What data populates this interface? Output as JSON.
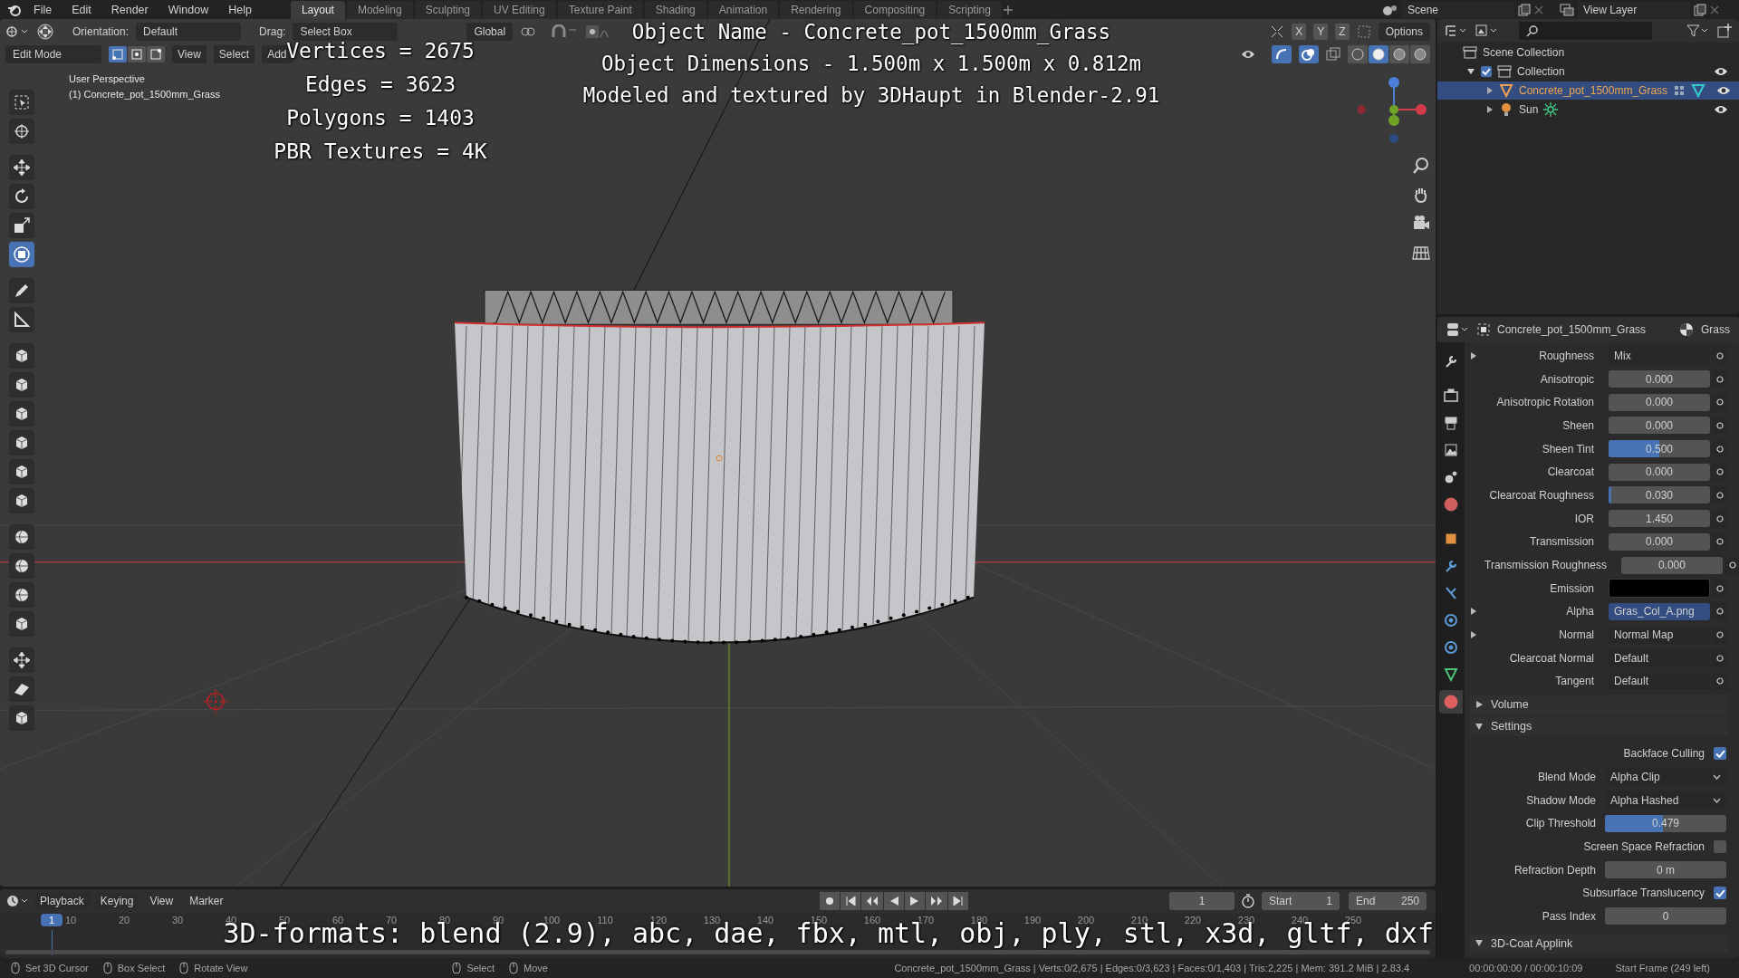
{
  "menu": [
    "File",
    "Edit",
    "Render",
    "Window",
    "Help"
  ],
  "workspace_tabs": [
    {
      "label": "Layout",
      "selected": true
    },
    {
      "label": "Modeling",
      "selected": false
    },
    {
      "label": "Sculpting",
      "selected": false
    },
    {
      "label": "UV Editing",
      "selected": false
    },
    {
      "label": "Texture Paint",
      "selected": false
    },
    {
      "label": "Shading",
      "selected": false
    },
    {
      "label": "Animation",
      "selected": false
    },
    {
      "label": "Rendering",
      "selected": false
    },
    {
      "label": "Compositing",
      "selected": false
    },
    {
      "label": "Scripting",
      "selected": false
    }
  ],
  "scene": "Scene",
  "view_layer": "View Layer",
  "viewport_header": {
    "orientation_label": "Orientation:",
    "orientation": "Default",
    "drag_label": "Drag:",
    "drag": "Select Box",
    "mode": "Edit Mode",
    "menus": [
      "View",
      "Select",
      "Add"
    ],
    "transform": "Global",
    "axes": [
      "X",
      "Y",
      "Z"
    ],
    "options": "Options",
    "select_modes": [
      {
        "selected": true
      },
      {
        "selected": false
      },
      {
        "selected": false
      }
    ],
    "shading_modes": [
      {
        "selected": false
      },
      {
        "selected": true
      },
      {
        "selected": false
      },
      {
        "selected": false
      }
    ]
  },
  "viewport": {
    "view_name": "User Perspective",
    "object_label": "(1) Concrete_pot_1500mm_Grass"
  },
  "overlay_stats": [
    "Vertices = 2675",
    "Edges = 3623",
    "Polygons = 1403",
    "PBR Textures = 4K"
  ],
  "overlay_info": [
    "Object Name - Concrete_pot_1500mm_Grass",
    "Object Dimensions -  1.500m x 1.500m x 0.812m",
    "Modeled and textured by 3DHaupt in Blender-2.91"
  ],
  "overlay_formats": "3D-formats: blend (2.9), abc, dae, fbx, mtl, obj, ply, stl, x3d, gltf, dxf",
  "outliner": {
    "root": "Scene Collection",
    "items": [
      {
        "label": "Collection",
        "checked": true,
        "expanded": true,
        "children": [
          {
            "label": "Concrete_pot_1500mm_Grass",
            "selected": true,
            "kind": "mesh"
          },
          {
            "label": "Sun",
            "selected": false,
            "kind": "light"
          }
        ]
      }
    ]
  },
  "properties": {
    "object": "Concrete_pot_1500mm_Grass",
    "material": "Grass",
    "rows": [
      {
        "kind": "link",
        "label": "Roughness",
        "value": "Mix",
        "expandable": true
      },
      {
        "kind": "slider",
        "label": "Anisotropic",
        "value": "0.000",
        "level": 0
      },
      {
        "kind": "slider",
        "label": "Anisotropic Rotation",
        "value": "0.000",
        "level": 0
      },
      {
        "kind": "slider",
        "label": "Sheen",
        "value": "0.000",
        "level": 0
      },
      {
        "kind": "slider",
        "label": "Sheen Tint",
        "value": "0.500",
        "level": 0.5
      },
      {
        "kind": "slider",
        "label": "Clearcoat",
        "value": "0.000",
        "level": 0
      },
      {
        "kind": "slider",
        "label": "Clearcoat Roughness",
        "value": "0.030",
        "level": 0.03
      },
      {
        "kind": "number",
        "label": "IOR",
        "value": "1.450"
      },
      {
        "kind": "slider",
        "label": "Transmission",
        "value": "0.000",
        "level": 0
      },
      {
        "kind": "slider",
        "label": "Transmission Roughness",
        "value": "0.000",
        "level": 0
      },
      {
        "kind": "color",
        "label": "Emission",
        "color": "#000000"
      },
      {
        "kind": "texture",
        "label": "Alpha",
        "value": "Gras_Col_A.png",
        "expandable": true
      },
      {
        "kind": "link",
        "label": "Normal",
        "value": "Normal Map",
        "expandable": true
      },
      {
        "kind": "link",
        "label": "Clearcoat Normal",
        "value": "Default",
        "expandable": false
      },
      {
        "kind": "link",
        "label": "Tangent",
        "value": "Default",
        "expandable": false
      }
    ],
    "panels": [
      {
        "title": "Volume",
        "expanded": false
      },
      {
        "title": "Settings",
        "expanded": true,
        "rows": [
          {
            "kind": "checkbox",
            "label": "Backface Culling",
            "checked": true
          },
          {
            "kind": "dropdown",
            "label": "Blend Mode",
            "value": "Alpha Clip"
          },
          {
            "kind": "dropdown",
            "label": "Shadow Mode",
            "value": "Alpha Hashed"
          },
          {
            "kind": "slider",
            "label": "Clip Threshold",
            "value": "0.479",
            "level": 0.479
          },
          {
            "kind": "checkbox",
            "label": "Screen Space Refraction",
            "checked": false
          },
          {
            "kind": "number",
            "label": "Refraction Depth",
            "value": "0 m"
          },
          {
            "kind": "checkbox",
            "label": "Subsurface Translucency",
            "checked": true
          },
          {
            "kind": "number",
            "label": "Pass Index",
            "value": "0"
          }
        ]
      },
      {
        "title": "3D-Coat Applink",
        "expanded": true
      }
    ]
  },
  "timeline": {
    "menus": [
      "Playback",
      "Keying",
      "View",
      "Marker"
    ],
    "current_frame": "1",
    "start_label": "Start",
    "start": "1",
    "end_label": "End",
    "end": "250",
    "playhead": "1",
    "ticks": [
      "10",
      "20",
      "30",
      "40",
      "50",
      "60",
      "70",
      "80",
      "90",
      "100",
      "110",
      "120",
      "130",
      "140",
      "150",
      "160",
      "170",
      "180",
      "190",
      "200",
      "210",
      "220",
      "230",
      "240",
      "250"
    ]
  },
  "status_bar": {
    "hints": [
      "Set 3D Cursor",
      "Box Select",
      "Rotate View",
      "Select",
      "Move"
    ],
    "stats": "Concrete_pot_1500mm_Grass | Verts:0/2,675 | Edges:0/3,623 | Faces:0/1,403 | Tris:2,225 | Mem: 391.2 MiB | 2.83.4",
    "time": "00:00:00:00 / 00:00:10:09",
    "frame_info": "Start Frame (249 left)"
  }
}
